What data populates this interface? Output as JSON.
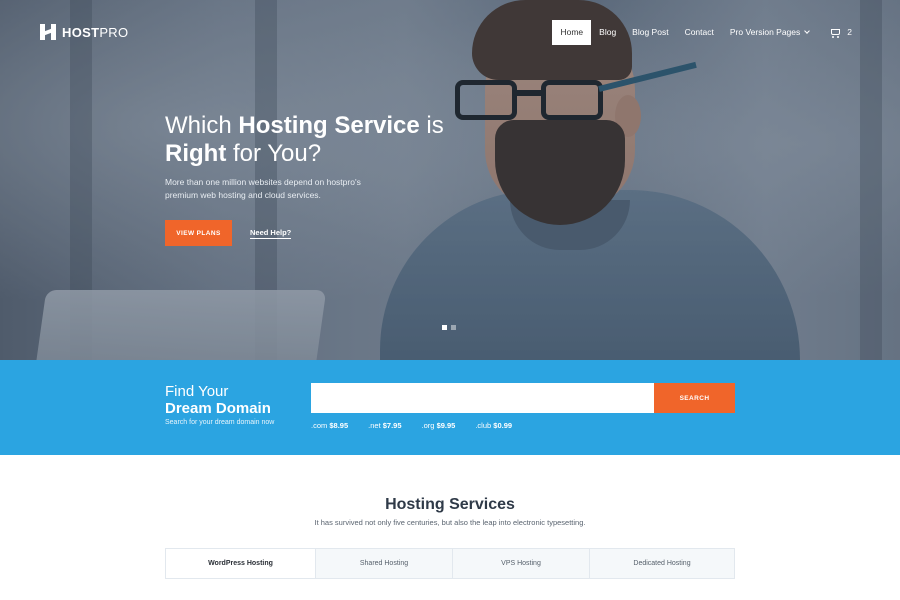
{
  "brand": {
    "bold": "HOST",
    "light": "PRO"
  },
  "nav": {
    "items": [
      "Home",
      "Blog",
      "Blog Post",
      "Contact",
      "Pro Version Pages"
    ],
    "active": "Home",
    "cart_count": "2"
  },
  "hero": {
    "headline_1a": "Which ",
    "headline_1b": "Hosting Service",
    "headline_1c": " is",
    "headline_2a": "Right",
    "headline_2b": " for You?",
    "subtext": "More than one million websites depend on hostpro's premium web hosting and cloud services.",
    "cta_label": "VIEW PLANS",
    "help_link": "Need Help?",
    "slides": 2,
    "active_slide": 1
  },
  "domain": {
    "title_line1": "Find Your",
    "title_line2": "Dream Domain",
    "caption": "Search for your dream domain now",
    "search_placeholder": "",
    "search_button": "SEARCH",
    "tlds": [
      {
        "ext": ".com",
        "price": "$8.95"
      },
      {
        "ext": ".net",
        "price": "$7.95"
      },
      {
        "ext": ".org",
        "price": "$9.95"
      },
      {
        "ext": ".club",
        "price": "$0.99"
      }
    ]
  },
  "services": {
    "title": "Hosting Services",
    "subtitle": "It has survived not only five centuries, but also the leap into electronic typesetting.",
    "tabs": [
      "WordPress Hosting",
      "Shared Hosting",
      "VPS Hosting",
      "Dedicated Hosting"
    ],
    "active_tab": "WordPress Hosting"
  },
  "colors": {
    "accent": "#f0652a",
    "domain_bg": "#2ba4e1",
    "heading": "#2f3a48"
  }
}
